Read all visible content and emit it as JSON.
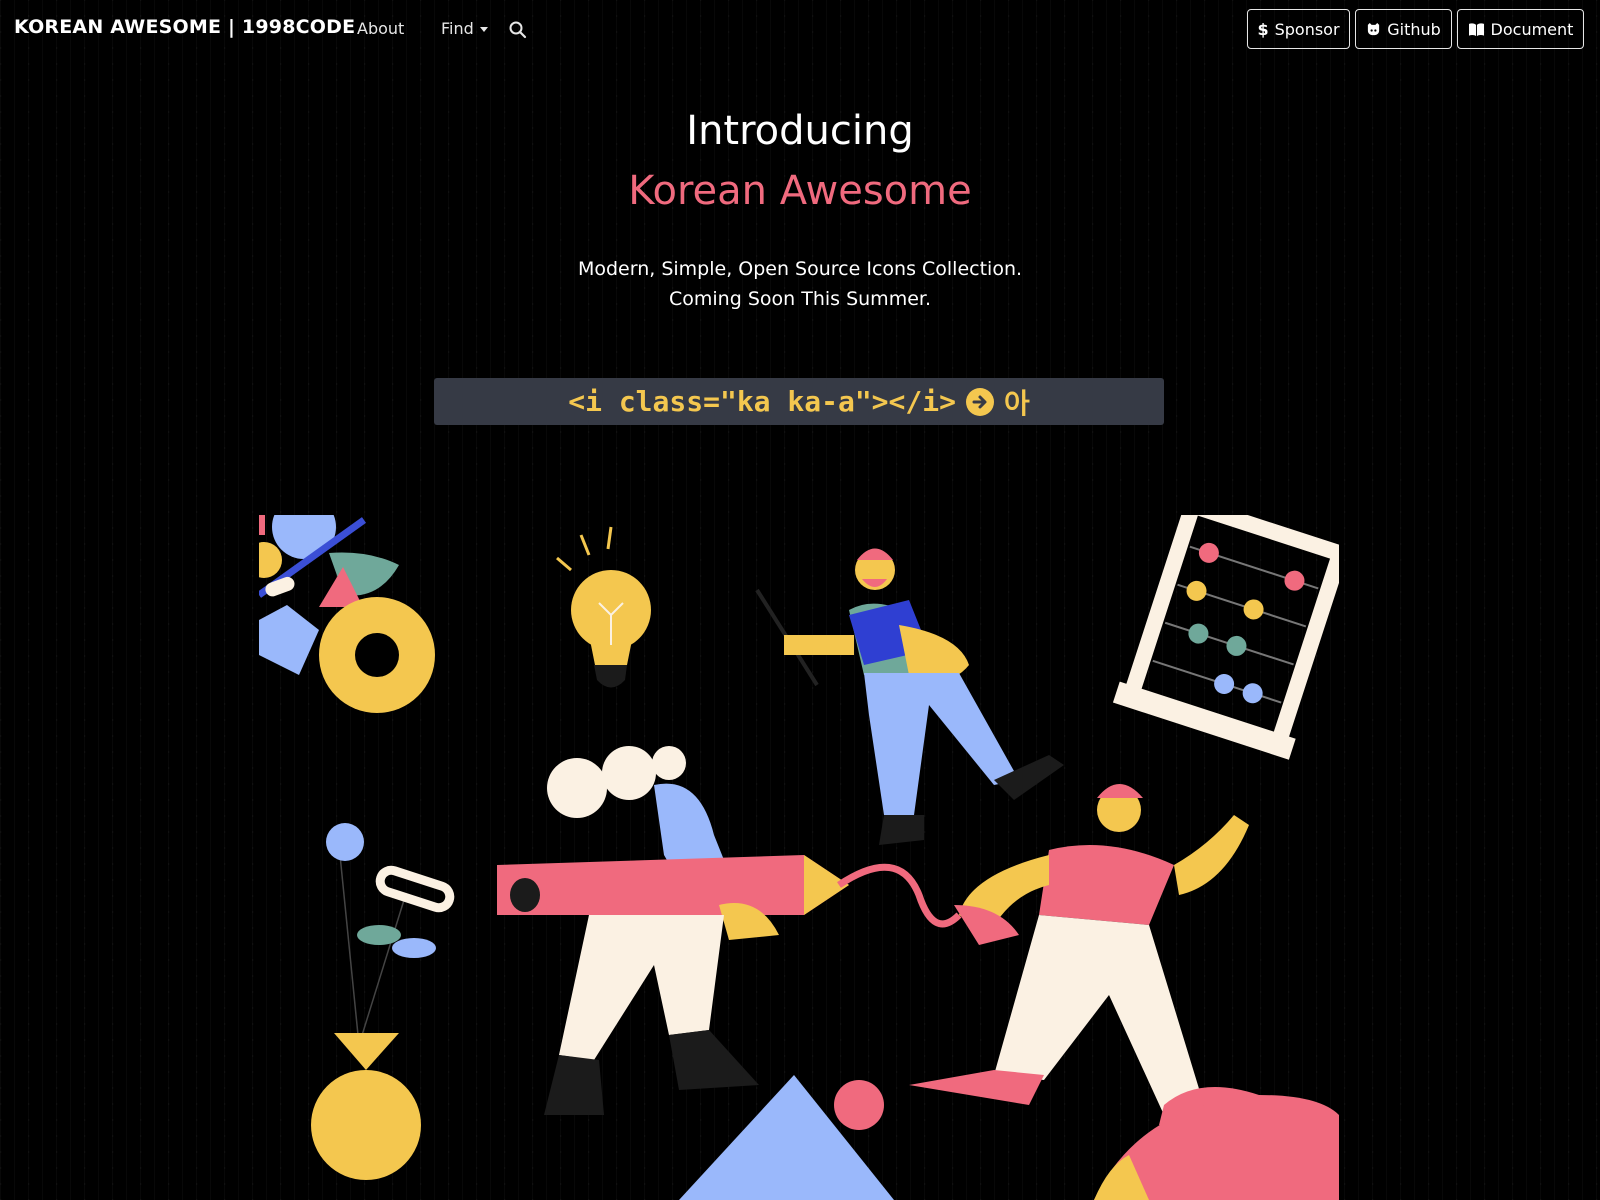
{
  "navbar": {
    "brand": "KOREAN AWESOME | 1998CODE",
    "about_label": "About",
    "find_label": "Find",
    "search_icon": "search-icon",
    "sponsor_label": "Sponsor",
    "github_label": "Github",
    "document_label": "Document"
  },
  "hero": {
    "intro": "Introducing",
    "title": "Korean Awesome",
    "subtitle_line1": "Modern, Simple, Open Source Icons Collection.",
    "subtitle_line2": "Coming Soon This Summer.",
    "code_snippet": "<i class=\"ka ka-a\"></i>",
    "result_glyph": "아"
  },
  "colors": {
    "background": "#000000",
    "accent_pink": "#f06a7e",
    "accent_yellow": "#f4c74f",
    "code_box_bg": "#363a45",
    "blue": "#9ab8fb",
    "green": "#6fa89a",
    "cream": "#fbf1e3"
  }
}
